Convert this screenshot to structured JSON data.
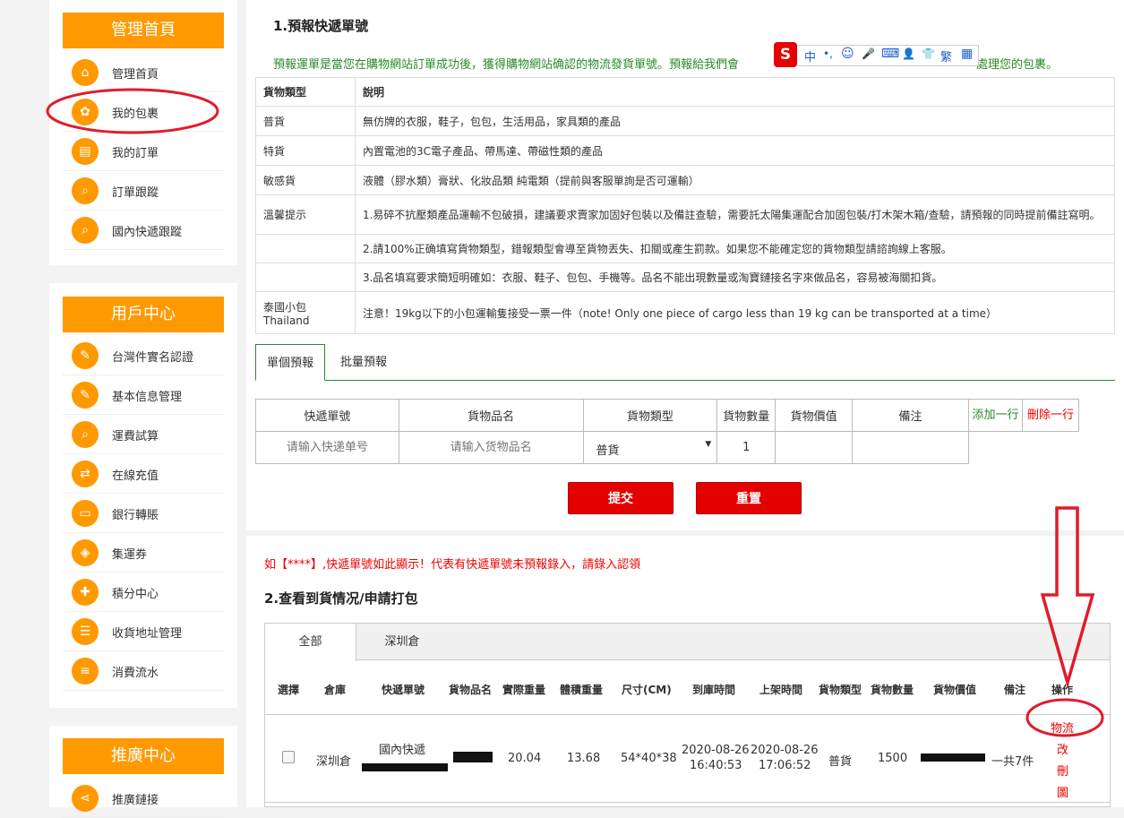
{
  "sidebar": {
    "sections": [
      {
        "title": "管理首頁",
        "items": [
          {
            "label": "管理首頁",
            "icon": "home-icon"
          },
          {
            "label": "我的包裹",
            "icon": "parcels-icon"
          },
          {
            "label": "我的訂單",
            "icon": "orders-icon"
          },
          {
            "label": "訂單跟蹤",
            "icon": "search-icon"
          },
          {
            "label": "國內快遞跟蹤",
            "icon": "search-icon"
          }
        ]
      },
      {
        "title": "用戶中心",
        "items": [
          {
            "label": "台灣件實名認證",
            "icon": "edit-icon"
          },
          {
            "label": "基本信息管理",
            "icon": "edit-icon"
          },
          {
            "label": "運費試算",
            "icon": "search-icon"
          },
          {
            "label": "在線充值",
            "icon": "exchange-icon"
          },
          {
            "label": "銀行轉賬",
            "icon": "card-icon"
          },
          {
            "label": "集運券",
            "icon": "ticket-icon"
          },
          {
            "label": "積分中心",
            "icon": "gift-icon"
          },
          {
            "label": "收貨地址管理",
            "icon": "address-icon"
          },
          {
            "label": "消費流水",
            "icon": "list-icon"
          }
        ]
      },
      {
        "title": "推廣中心",
        "items": [
          {
            "label": "推廣鏈接",
            "icon": "share-icon"
          }
        ]
      }
    ]
  },
  "section1": {
    "title": "1.預報快遞單號",
    "intro_left": "預報運單是當您在購物網站訂單成功後，獲得購物網站确認的物流發貨單號。預報給我們會",
    "intro_right": "處理您的包裹。",
    "types_table": {
      "header": [
        "貨物類型",
        "說明"
      ],
      "rows": [
        [
          "普貨",
          "無仿牌的衣服，鞋子，包包，生活用品，家具類的產品"
        ],
        [
          "特貨",
          "內置電池的3C電子產品、帶馬達、帶磁性類的產品"
        ],
        [
          "敏感貨",
          "液體（膠水類）膏狀、化妝品類 純電類（提前與客服單詢是否可運輸）"
        ],
        [
          "溫馨提示",
          "1.易碎不抗壓類產品運輸不包破損，建議要求賣家加固好包裝以及備註查驗，需要託太陽集運配合加固包裝/打木架木箱/查驗，請預報的同時提前備註寫明。"
        ],
        [
          "",
          "2.請100%正确填寫貨物類型，錯報類型會導至貨物丟失、扣關或產生罰款。如果您不能確定您的貨物類型請諮詢線上客服。"
        ],
        [
          "",
          "3.品名填寫要求簡短明確如：衣服、鞋子、包包、手機等。品名不能出現數量或淘寶鏈接名字來做品名，容易被海關扣貨。"
        ],
        [
          "泰國小包\nThailand",
          "注意！19kg以下的小包運輸隻接受一票一件（note! Only one piece of cargo less than 19 kg can be transported at a time）"
        ]
      ]
    },
    "tabs": [
      "單個預報",
      "批量預報"
    ],
    "form": {
      "headers": [
        "快遞單號",
        "貨物品名",
        "貨物類型",
        "貨物數量",
        "貨物價值",
        "備注"
      ],
      "add_row": "添加一行",
      "delete_row": "刪除一行",
      "tracking_placeholder": "请输入快递单号",
      "name_placeholder": "请输入货物品名",
      "type_value": "普貨",
      "quantity": "1",
      "submit": "提交",
      "reset": "重置"
    }
  },
  "warning": "如【****】,快遞單號如此顯示！代表有快遞單號未預報錄入，請錄入認領",
  "section2": {
    "title": "2.查看到貨情况/申請打包",
    "tabs": [
      "全部",
      "深圳倉"
    ],
    "columns": [
      "選擇",
      "倉庫",
      "快遞單號",
      "貨物品名",
      "實際重量",
      "體積重量",
      "尺寸(CM)",
      "到庫時間",
      "上架時間",
      "貨物類型",
      "貨物數量",
      "貨物價值",
      "備注",
      "操作"
    ],
    "row": {
      "warehouse": "深圳倉",
      "courier": "國內快遞",
      "actual_weight": "20.04",
      "volume_weight": "13.68",
      "size": "54*40*38",
      "arrival_date": "2020-08-26",
      "arrival_time": "16:40:53",
      "shelf_date": "2020-08-26",
      "shelf_time": "17:06:52",
      "type": "普貨",
      "quantity": "1500",
      "note": "一共7件",
      "actions": [
        "物流",
        "改",
        "刪",
        "圖"
      ]
    }
  },
  "ime_bar": {
    "logo": "S",
    "items": [
      "中",
      "•,",
      "☺",
      "🎤",
      "⌨",
      "👤",
      "👕",
      "繁",
      "▦"
    ]
  },
  "colors": {
    "accent": "#ff9900",
    "green": "#2a8a2a",
    "red": "#e50000",
    "annotation": "#e01c2a"
  }
}
